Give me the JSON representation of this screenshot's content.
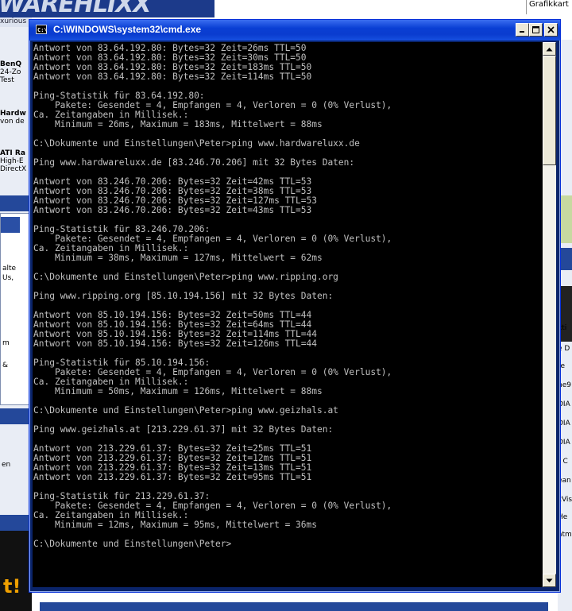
{
  "background": {
    "logo_text": "WAREHLIXX",
    "top_right_text": "Grafikkart",
    "strip_text": "xurious",
    "left_items": [
      {
        "title": "BenQ",
        "lines": [
          "24-Zo",
          "Test"
        ]
      },
      {
        "title": "Hardw",
        "lines": [
          "von de"
        ]
      },
      {
        "title": "ATI Ra",
        "lines": [
          "High-E",
          "DirectX"
        ]
      }
    ],
    "left_box_lines": [
      "alte",
      "Us,",
      "m",
      "&"
    ],
    "left_lower_text": "en",
    "left_bottom_text": "t!",
    "right_items": [
      "kti",
      "e D",
      "re",
      "ne9",
      "DIA",
      "DIA",
      "DIA",
      "r C",
      "ean",
      "cVis",
      "He",
      "atm"
    ]
  },
  "window": {
    "title": "C:\\WINDOWS\\system32\\cmd.exe",
    "icon": "cmd-icon",
    "buttons": {
      "minimize": "minimize-icon",
      "maximize": "maximize-icon",
      "close": "close-icon"
    }
  },
  "console": {
    "lines": [
      "Antwort von 83.64.192.80: Bytes=32 Zeit=26ms TTL=50",
      "Antwort von 83.64.192.80: Bytes=32 Zeit=30ms TTL=50",
      "Antwort von 83.64.192.80: Bytes=32 Zeit=183ms TTL=50",
      "Antwort von 83.64.192.80: Bytes=32 Zeit=114ms TTL=50",
      "",
      "Ping-Statistik für 83.64.192.80:",
      "    Pakete: Gesendet = 4, Empfangen = 4, Verloren = 0 (0% Verlust),",
      "Ca. Zeitangaben in Millisek.:",
      "    Minimum = 26ms, Maximum = 183ms, Mittelwert = 88ms",
      "",
      "C:\\Dokumente und Einstellungen\\Peter>ping www.hardwareluxx.de",
      "",
      "Ping www.hardwareluxx.de [83.246.70.206] mit 32 Bytes Daten:",
      "",
      "Antwort von 83.246.70.206: Bytes=32 Zeit=42ms TTL=53",
      "Antwort von 83.246.70.206: Bytes=32 Zeit=38ms TTL=53",
      "Antwort von 83.246.70.206: Bytes=32 Zeit=127ms TTL=53",
      "Antwort von 83.246.70.206: Bytes=32 Zeit=43ms TTL=53",
      "",
      "Ping-Statistik für 83.246.70.206:",
      "    Pakete: Gesendet = 4, Empfangen = 4, Verloren = 0 (0% Verlust),",
      "Ca. Zeitangaben in Millisek.:",
      "    Minimum = 38ms, Maximum = 127ms, Mittelwert = 62ms",
      "",
      "C:\\Dokumente und Einstellungen\\Peter>ping www.ripping.org",
      "",
      "Ping www.ripping.org [85.10.194.156] mit 32 Bytes Daten:",
      "",
      "Antwort von 85.10.194.156: Bytes=32 Zeit=50ms TTL=44",
      "Antwort von 85.10.194.156: Bytes=32 Zeit=64ms TTL=44",
      "Antwort von 85.10.194.156: Bytes=32 Zeit=114ms TTL=44",
      "Antwort von 85.10.194.156: Bytes=32 Zeit=126ms TTL=44",
      "",
      "Ping-Statistik für 85.10.194.156:",
      "    Pakete: Gesendet = 4, Empfangen = 4, Verloren = 0 (0% Verlust),",
      "Ca. Zeitangaben in Millisek.:",
      "    Minimum = 50ms, Maximum = 126ms, Mittelwert = 88ms",
      "",
      "C:\\Dokumente und Einstellungen\\Peter>ping www.geizhals.at",
      "",
      "Ping www.geizhals.at [213.229.61.37] mit 32 Bytes Daten:",
      "",
      "Antwort von 213.229.61.37: Bytes=32 Zeit=25ms TTL=51",
      "Antwort von 213.229.61.37: Bytes=32 Zeit=12ms TTL=51",
      "Antwort von 213.229.61.37: Bytes=32 Zeit=13ms TTL=51",
      "Antwort von 213.229.61.37: Bytes=32 Zeit=95ms TTL=51",
      "",
      "Ping-Statistik für 213.229.61.37:",
      "    Pakete: Gesendet = 4, Empfangen = 4, Verloren = 0 (0% Verlust),",
      "Ca. Zeitangaben in Millisek.:",
      "    Minimum = 12ms, Maximum = 95ms, Mittelwert = 36ms",
      "",
      "C:\\Dokumente und Einstellungen\\Peter>"
    ]
  },
  "colors": {
    "titlebar": "#0a3fd4",
    "console_bg": "#000000",
    "console_text": "#c0c0c0"
  }
}
